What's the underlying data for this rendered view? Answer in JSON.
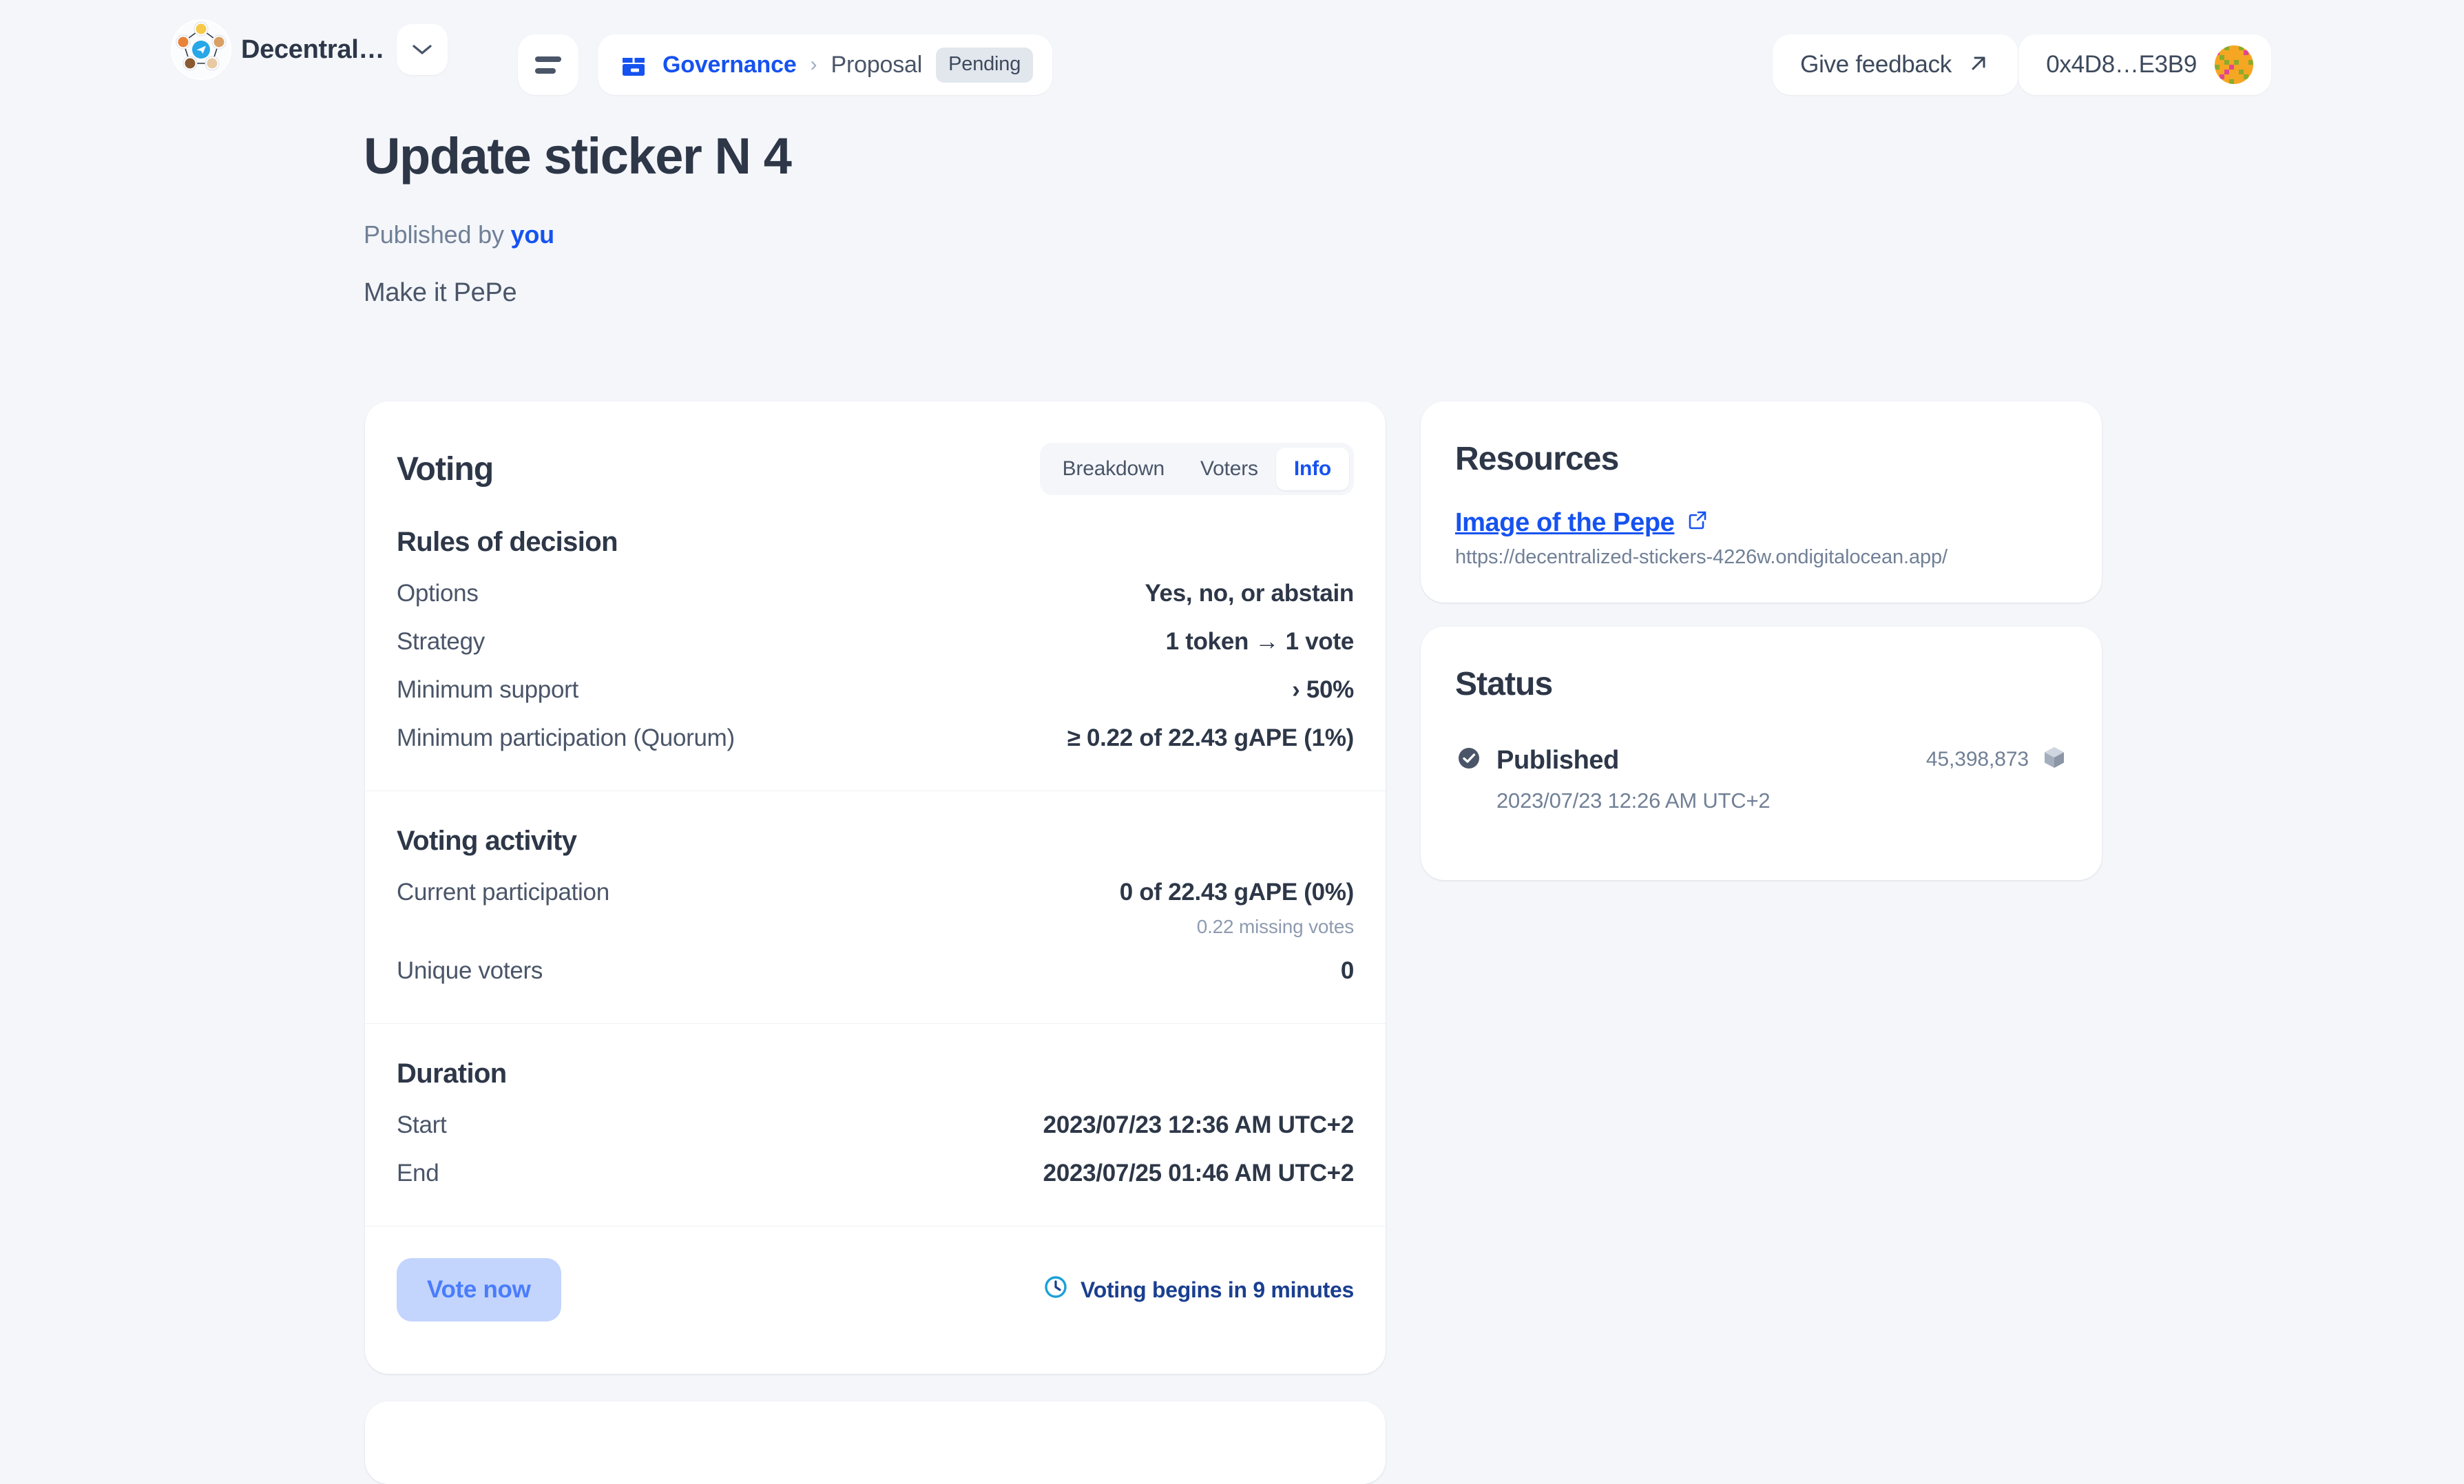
{
  "topbar": {
    "org_name": "Decentral…",
    "org_logo_icon": "telegram-network-logo",
    "caret_icon": "chevron-down-icon",
    "menu_icon": "menu-icon",
    "breadcrumb": {
      "icon": "package-box-icon",
      "link": "Governance",
      "separator": "›",
      "current": "Proposal",
      "badge": "Pending"
    },
    "feedback": {
      "label": "Give feedback",
      "icon": "external-arrow-icon"
    },
    "wallet": {
      "address": "0x4D8…E3B9",
      "avatar_icon": "blockie-avatar"
    }
  },
  "page": {
    "title": "Update sticker N 4",
    "published_prefix": "Published by ",
    "published_author": "you",
    "summary": "Make it PePe"
  },
  "voting": {
    "title": "Voting",
    "tabs": [
      {
        "label": "Breakdown",
        "active": false
      },
      {
        "label": "Voters",
        "active": false
      },
      {
        "label": "Info",
        "active": true
      }
    ],
    "rules": {
      "title": "Rules of decision",
      "rows": [
        {
          "key": "Options",
          "value": "Yes, no, or abstain"
        },
        {
          "key": "Strategy",
          "value": "1 token → 1 vote"
        },
        {
          "key": "Minimum support",
          "value": "› 50%"
        },
        {
          "key": "Minimum participation (Quorum)",
          "value": "≥ 0.22 of 22.43 gAPE (1%)"
        }
      ]
    },
    "activity": {
      "title": "Voting activity",
      "participation_key": "Current participation",
      "participation_value": "0 of 22.43 gAPE (0%)",
      "participation_sub": "0.22 missing votes",
      "unique_key": "Unique voters",
      "unique_value": "0"
    },
    "duration": {
      "title": "Duration",
      "rows": [
        {
          "key": "Start",
          "value": "2023/07/23 12:36 AM UTC+2"
        },
        {
          "key": "End",
          "value": "2023/07/25 01:46 AM UTC+2"
        }
      ]
    },
    "footer": {
      "vote_button": "Vote now",
      "note_icon": "clock-icon",
      "note": "Voting begins in 9 minutes"
    }
  },
  "resources": {
    "title": "Resources",
    "link_label": "Image of the Pepe",
    "link_icon": "external-link-icon",
    "url": "https://decentralized-stickers-4226w.ondigitalocean.app/"
  },
  "status": {
    "title": "Status",
    "state_icon": "check-circle-icon",
    "state": "Published",
    "date": "2023/07/23 12:26 AM UTC+2",
    "block_number": "45,398,873",
    "block_icon": "cube-icon"
  },
  "colors": {
    "brand_blue": "#1652f0",
    "page_bg": "#f4f6fa",
    "card_bg": "#ffffff",
    "text_dark": "#2d3748",
    "text_muted": "#718096",
    "badge_bg": "#e2e6ed",
    "vote_btn_bg": "#c3d4fd",
    "clock_cyan": "#1aa0d8"
  }
}
